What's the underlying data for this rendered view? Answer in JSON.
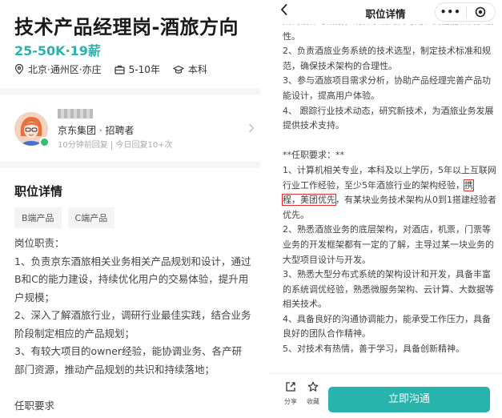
{
  "left": {
    "job_title": "技术产品经理岗-酒旅方向",
    "salary": "25-50K·19薪",
    "meta": {
      "location": "北京·通州区·亦庄",
      "experience": "5-10年",
      "education": "本科"
    },
    "recruiter": {
      "company_role": "京东集团 · 招聘者",
      "activity": "10分钟前回复 | 今日回复10+次"
    },
    "section_title": "职位详情",
    "tags": [
      "B端产品",
      "C端产品"
    ],
    "description": [
      "岗位职责：",
      "1、负责京东酒旅相关业务相关产品规划和设计，通过B和C的能力建设，持续优化用户的交易体验，提升用户规模；",
      "2、深入了解酒旅行业，调研行业最佳实践，结合业务阶段制定相应的产品规划；",
      "3、有较大项目的owner经验，能协调业务、各产研部门资源，推动产品规划的共识和持续落地；",
      "",
      "任职要求"
    ]
  },
  "right": {
    "nav_title": "职位详情",
    "capsule_dots": "•••",
    "lines_a": [
      "架构设计与规划，确保系统的高可用、高性能和高扩展性。",
      "2、负责酒旅业务系统的技术选型，制定技术标准和规范，确保技术架构的合理性。",
      "3、参与酒旅项目需求分析，协助产品经理完善产品功能设计，提高用户体验。",
      "4、 跟踪行业技术动态，研究新技术，为酒旅业务发展提供技术支持。"
    ],
    "req_title": "**任职要求：**",
    "req_1_pre": "1、计算机相关专业，本科及以上学历，5年以上互联网行业工作经验，至少5年酒旅行业的架构经验，",
    "req_1_hl_a": "携",
    "req_1_hl_b": "程，美团优先",
    "req_1_post": "，有某块业务技术架构从0到1搭建经验者优先。",
    "lines_b": [
      "2、熟悉酒旅业务的底层架构，对酒店，机票，门票等业务的开发框架都有一定的了解，主导过某一块业务的大型项目设计与开发。",
      "3、熟悉大型分布式系统的架构设计和开发，具备丰富的系统调优经验，熟悉微服务架构、云计算、大数据等相关技术。",
      "4、具备良好的沟通协调能力，能承受工作压力，具备良好的团队合作精神。",
      "5、对技术有热情，善于学习，具备创新精神。"
    ],
    "bottom": {
      "share_label": "分享",
      "fav_label": "收藏",
      "chat_label": "立即沟通"
    }
  },
  "colors": {
    "accent": "#29b3ad",
    "highlight_box": "#e03030",
    "online": "#30c06a"
  }
}
